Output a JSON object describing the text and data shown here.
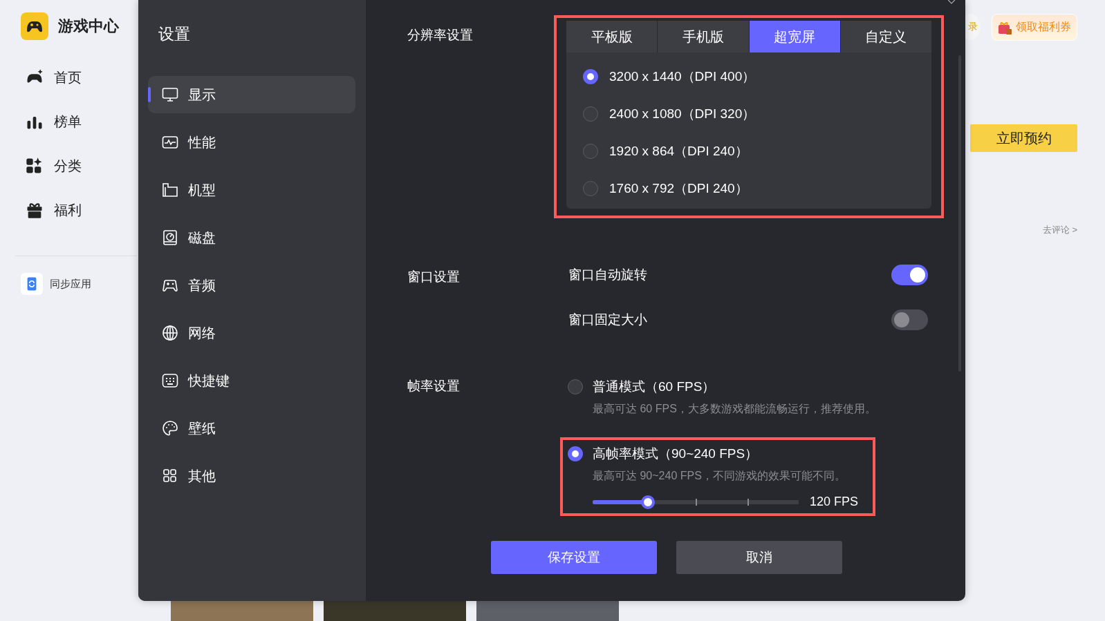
{
  "app": {
    "title": "游戏中心",
    "nav": [
      {
        "label": "首页"
      },
      {
        "label": "榜单"
      },
      {
        "label": "分类"
      },
      {
        "label": "福利"
      }
    ],
    "sync": "同步应用"
  },
  "background": {
    "chip": "录",
    "coupon": "领取福利券",
    "reserve": "立即预约",
    "comment": "去评论 >"
  },
  "dialog": {
    "title": "设置",
    "menu": [
      {
        "label": "显示",
        "selected": true
      },
      {
        "label": "性能",
        "selected": false
      },
      {
        "label": "机型",
        "selected": false
      },
      {
        "label": "磁盘",
        "selected": false
      },
      {
        "label": "音频",
        "selected": false
      },
      {
        "label": "网络",
        "selected": false
      },
      {
        "label": "快捷键",
        "selected": false
      },
      {
        "label": "壁纸",
        "selected": false
      },
      {
        "label": "其他",
        "selected": false
      }
    ],
    "resolution": {
      "label": "分辨率设置",
      "highlighted": true,
      "tabs": [
        {
          "label": "平板版",
          "selected": false
        },
        {
          "label": "手机版",
          "selected": false
        },
        {
          "label": "超宽屏",
          "selected": true
        },
        {
          "label": "自定义",
          "selected": false
        }
      ],
      "options": [
        {
          "label": "3200 x 1440（DPI 400）",
          "selected": true
        },
        {
          "label": "2400 x 1080（DPI 320）",
          "selected": false
        },
        {
          "label": "1920 x 864（DPI 240）",
          "selected": false
        },
        {
          "label": "1760 x 792（DPI 240）",
          "selected": false
        }
      ]
    },
    "window": {
      "label": "窗口设置",
      "toggles": [
        {
          "label": "窗口自动旋转",
          "on": true
        },
        {
          "label": "窗口固定大小",
          "on": false
        }
      ]
    },
    "framerate": {
      "label": "帧率设置",
      "modes": [
        {
          "label": "普通模式（60 FPS）",
          "description": "最高可达 60 FPS，大多数游戏都能流畅运行，推荐使用。",
          "selected": false,
          "highlighted": false
        },
        {
          "label": "高帧率模式（90~240 FPS）",
          "description": "最高可达 90~240 FPS，不同游戏的效果可能不同。",
          "selected": true,
          "highlighted": true,
          "slider": {
            "level": 0.27,
            "reading": "120 FPS"
          }
        }
      ]
    },
    "buttons": [
      {
        "label": "保存设置",
        "kind": "primary"
      },
      {
        "label": "取消",
        "kind": "secondary"
      }
    ]
  }
}
